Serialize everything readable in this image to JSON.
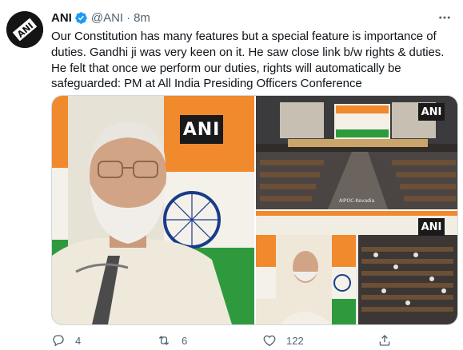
{
  "tweet": {
    "avatar": {
      "text": "ANI",
      "icon": "ani-avatar-icon"
    },
    "display_name": "ANI",
    "verified": true,
    "handle": "@ANI",
    "separator": "·",
    "time": "8m",
    "text_lines": [
      "Our Constitution has many features but a special feature is importance of",
      "duties. Gandhi ji was very keen on it. He saw close link b/w rights & duties.",
      "He felt that once we perform our duties, rights will automatically be",
      "safeguarded: PM at All India Presiding Officers Conference"
    ],
    "media": {
      "left": {
        "watermark": "ANI"
      },
      "right_top": {
        "watermark": "ANI",
        "caption": "AIPOC-Kevadia"
      },
      "right_bottom": {
        "watermark": "ANI"
      }
    },
    "actions": {
      "reply": {
        "icon": "reply-icon",
        "count": "4"
      },
      "retweet": {
        "icon": "retweet-icon",
        "count": "6"
      },
      "like": {
        "icon": "heart-icon",
        "count": "122"
      },
      "share": {
        "icon": "share-icon"
      }
    }
  },
  "colors": {
    "text_primary": "#0f1419",
    "text_secondary": "#536471",
    "verified_blue": "#1d9bf0",
    "media_border": "#cfd9de"
  }
}
